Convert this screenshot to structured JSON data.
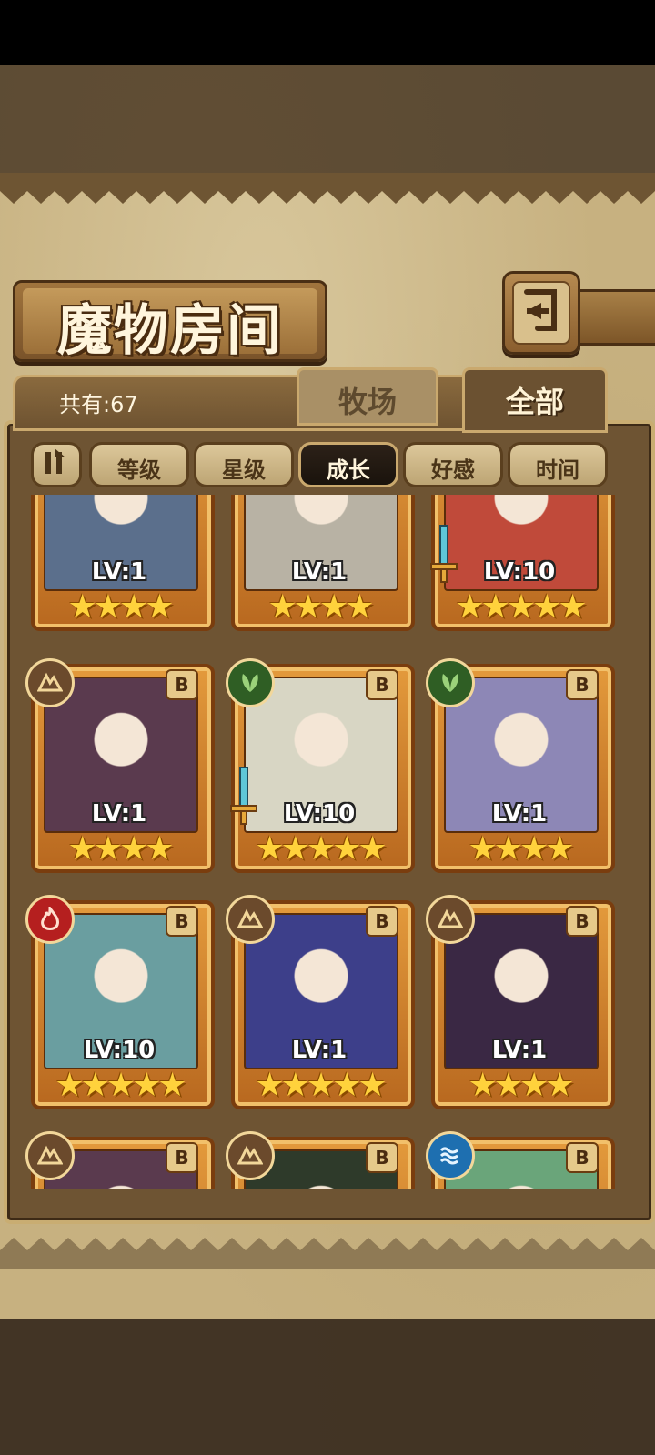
{
  "header": {
    "title": "魔物房间"
  },
  "count": {
    "text": "共有:67"
  },
  "tabs": [
    {
      "label": "牧场",
      "active": false
    },
    {
      "label": "全部",
      "active": true
    }
  ],
  "sort": {
    "buttons": [
      {
        "label": "等级",
        "active": false
      },
      {
        "label": "星级",
        "active": false
      },
      {
        "label": "成长",
        "active": true
      },
      {
        "label": "好感",
        "active": false
      },
      {
        "label": "时间",
        "active": false
      }
    ]
  },
  "monsters": [
    {
      "level": "LV:1",
      "stars": "★★★★",
      "element": null,
      "badge": null,
      "weapon": false,
      "color": "#5b6f8c"
    },
    {
      "level": "LV:1",
      "stars": "★★★★",
      "element": null,
      "badge": null,
      "weapon": false,
      "color": "#b8b2a4"
    },
    {
      "level": "LV:10",
      "stars": "★★★★★",
      "element": null,
      "badge": null,
      "weapon": true,
      "color": "#c04a3a"
    },
    {
      "level": "LV:1",
      "stars": "★★★★",
      "element": "earth-icon",
      "badge": "B",
      "weapon": false,
      "color": "#5a3a4e"
    },
    {
      "level": "LV:10",
      "stars": "★★★★★",
      "element": "grass-icon",
      "badge": "B",
      "weapon": true,
      "color": "#d8d6c4"
    },
    {
      "level": "LV:1",
      "stars": "★★★★",
      "element": "grass-icon",
      "badge": "B",
      "weapon": false,
      "color": "#8d87b6"
    },
    {
      "level": "LV:10",
      "stars": "★★★★★",
      "element": "fire-icon",
      "badge": "B",
      "weapon": false,
      "color": "#6a9ea0"
    },
    {
      "level": "LV:1",
      "stars": "★★★★★",
      "element": "earth-icon",
      "badge": "B",
      "weapon": false,
      "color": "#3d3f8a"
    },
    {
      "level": "LV:1",
      "stars": "★★★★",
      "element": "earth-icon",
      "badge": "B",
      "weapon": false,
      "color": "#3a2844"
    },
    {
      "level": "",
      "stars": "",
      "element": "earth-icon",
      "badge": "B",
      "weapon": false,
      "color": "#5a3a4e"
    },
    {
      "level": "",
      "stars": "",
      "element": "earth-icon",
      "badge": "B",
      "weapon": false,
      "color": "#2e3a2a"
    },
    {
      "level": "",
      "stars": "",
      "element": "water-icon",
      "badge": "B",
      "weapon": false,
      "color": "#6aa57a"
    }
  ]
}
